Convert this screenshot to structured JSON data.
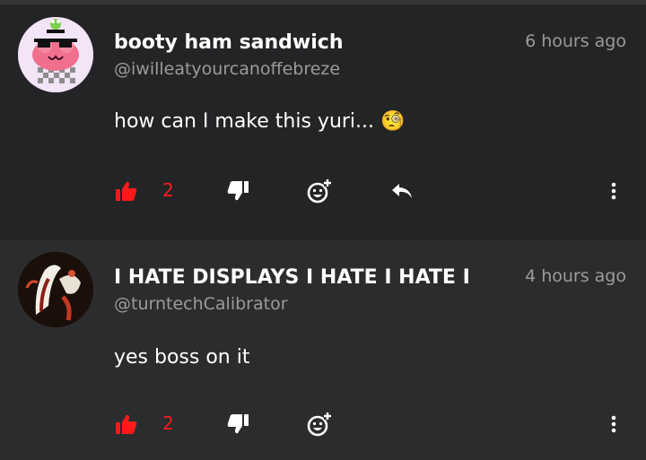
{
  "comments": [
    {
      "author_name": "booty ham sandwich",
      "author_handle": "@iwilleatyourcanoffebreze",
      "time": "6 hours ago",
      "text": "how can I make this yuri... 🧐",
      "likes": "2",
      "has_reply": true
    },
    {
      "author_name": "I HATE DISPLAYS I HATE I HATE I",
      "author_handle": "@turntechCalibrator",
      "time": "4 hours ago",
      "text": "yes boss on it",
      "likes": "2",
      "has_reply": false
    }
  ],
  "colors": {
    "like_active": "#ff1a1a",
    "icon": "#ffffff",
    "muted_text": "#9a9b9d",
    "card_bg_1": "#232426",
    "card_bg_2": "#2b2c2e"
  },
  "icons": {
    "like": "thumbs-up-icon",
    "dislike": "thumbs-down-icon",
    "react": "add-reaction-icon",
    "reply": "reply-icon",
    "more": "more-vertical-icon"
  }
}
